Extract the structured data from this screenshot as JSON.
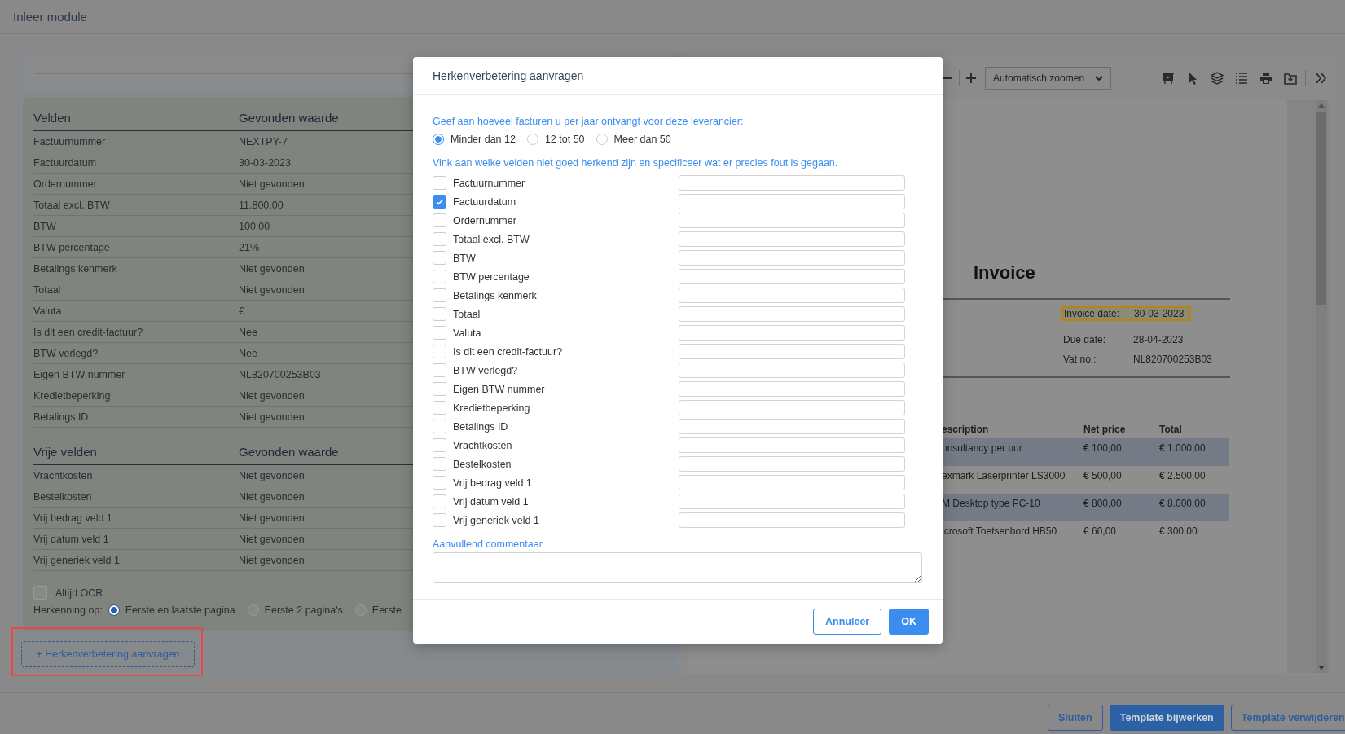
{
  "header": {
    "title": "Inleer module"
  },
  "fields_table": {
    "columns": [
      "Velden",
      "Gevonden waarde"
    ],
    "rows": [
      {
        "field": "Factuurnummer",
        "value": "NEXTPY-7"
      },
      {
        "field": "Factuurdatum",
        "value": "30-03-2023"
      },
      {
        "field": "Ordernummer",
        "value": "Niet gevonden"
      },
      {
        "field": "Totaal excl. BTW",
        "value": "11.800,00"
      },
      {
        "field": "BTW",
        "value": "100,00"
      },
      {
        "field": "BTW percentage",
        "value": "21%"
      },
      {
        "field": "Betalings kenmerk",
        "value": "Niet gevonden"
      },
      {
        "field": "Totaal",
        "value": "Niet gevonden"
      },
      {
        "field": "Valuta",
        "value": "€"
      },
      {
        "field": "Is dit een credit-factuur?",
        "value": "Nee"
      },
      {
        "field": "BTW verlegd?",
        "value": "Nee"
      },
      {
        "field": "Eigen BTW nummer",
        "value": "NL820700253B03"
      },
      {
        "field": "Kredietbeperking",
        "value": "Niet gevonden"
      },
      {
        "field": "Betalings ID",
        "value": "Niet gevonden"
      }
    ]
  },
  "free_fields_table": {
    "columns": [
      "Vrije velden",
      "Gevonden waarde"
    ],
    "rows": [
      {
        "field": "Vrachtkosten",
        "value": "Niet gevonden"
      },
      {
        "field": "Bestelkosten",
        "value": "Niet gevonden"
      },
      {
        "field": "Vrij bedrag veld 1",
        "value": "Niet gevonden"
      },
      {
        "field": "Vrij datum veld 1",
        "value": "Niet gevonden"
      },
      {
        "field": "Vrij generiek veld 1",
        "value": "Niet gevonden"
      }
    ]
  },
  "always_ocr": {
    "label": "Altijd OCR",
    "checked": false
  },
  "recognition": {
    "label": "Herkenning op:",
    "options": [
      {
        "label": "Eerste en laatste pagina",
        "selected": true
      },
      {
        "label": "Eerste 2 pagina's",
        "selected": false
      },
      {
        "label": "Eerste",
        "selected": false
      }
    ]
  },
  "request_button": {
    "label": "+ Herkenverbetering aanvragen",
    "highlighted": true
  },
  "viewer": {
    "zoom_select": "Automatisch zoomen",
    "document": {
      "title": "Invoice",
      "meta": [
        {
          "label": "Invoice date:",
          "value": "30-03-2023",
          "highlighted": true
        },
        {
          "label": "Due date:",
          "value": "28-04-2023",
          "highlighted": false
        },
        {
          "label": "Vat no.:",
          "value": "NL820700253B03",
          "highlighted": false
        }
      ],
      "columns": [
        "escription",
        "Net price",
        "Total"
      ],
      "rows": [
        {
          "cells": [
            "onsultancy per uur",
            "€ 100,00",
            "€ 1.000,00"
          ],
          "shaded": true
        },
        {
          "cells": [
            "exmark Laserprinter LS3000",
            "€ 500,00",
            "€ 2.500,00"
          ],
          "shaded": false
        },
        {
          "cells": [
            "M Desktop type PC-10",
            "€ 800,00",
            "€ 8.000,00"
          ],
          "shaded": true
        },
        {
          "cells": [
            "icrosoft Toetsenbord HB50",
            "€ 60,00",
            "€ 300,00"
          ],
          "shaded": false
        }
      ]
    }
  },
  "modal": {
    "title": "Herkenverbetering aanvragen",
    "question": "Geef aan hoeveel facturen u per jaar ontvangt voor deze leverancier:",
    "frequency": [
      {
        "label": "Minder dan 12",
        "selected": true
      },
      {
        "label": "12 tot 50",
        "selected": false
      },
      {
        "label": "Meer dan 50",
        "selected": false
      }
    ],
    "instruction": "Vink aan welke velden niet goed herkend zijn en specificeer wat er precies fout is gegaan.",
    "fields": [
      {
        "label": "Factuurnummer",
        "checked": false
      },
      {
        "label": "Factuurdatum",
        "checked": true
      },
      {
        "label": "Ordernummer",
        "checked": false
      },
      {
        "label": "Totaal excl. BTW",
        "checked": false
      },
      {
        "label": "BTW",
        "checked": false
      },
      {
        "label": "BTW percentage",
        "checked": false
      },
      {
        "label": "Betalings kenmerk",
        "checked": false
      },
      {
        "label": "Totaal",
        "checked": false
      },
      {
        "label": "Valuta",
        "checked": false
      },
      {
        "label": "Is dit een credit-factuur?",
        "checked": false
      },
      {
        "label": "BTW verlegd?",
        "checked": false
      },
      {
        "label": "Eigen BTW nummer",
        "checked": false
      },
      {
        "label": "Kredietbeperking",
        "checked": false
      },
      {
        "label": "Betalings ID",
        "checked": false
      },
      {
        "label": "Vrachtkosten",
        "checked": false
      },
      {
        "label": "Bestelkosten",
        "checked": false
      },
      {
        "label": "Vrij bedrag veld 1",
        "checked": false
      },
      {
        "label": "Vrij datum veld 1",
        "checked": false
      },
      {
        "label": "Vrij generiek veld 1",
        "checked": false
      }
    ],
    "comment_label": "Aanvullend commentaar",
    "buttons": [
      {
        "label": "Annuleer",
        "kind": "outline"
      },
      {
        "label": "OK",
        "kind": "primary"
      }
    ]
  },
  "footer_buttons": [
    {
      "label": "Sluiten",
      "kind": "outline"
    },
    {
      "label": "Template bijwerken",
      "kind": "primary"
    },
    {
      "label": "Template verwijderen",
      "kind": "outline"
    }
  ]
}
